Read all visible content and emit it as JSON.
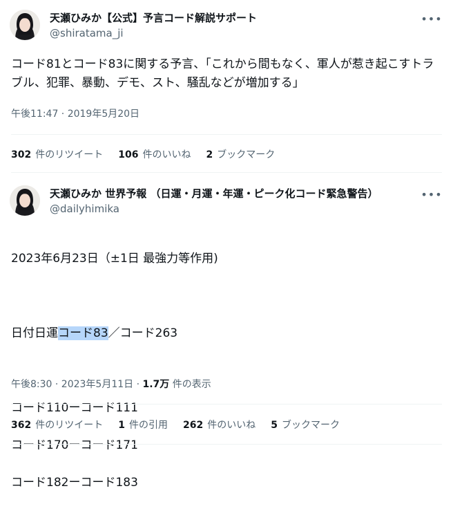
{
  "tweet1": {
    "display_name": "天瀬ひみか【公式】予言コード解説サポート",
    "handle": "@shiratama_ji",
    "text": "コード81とコード83に関する予言、「これから間もなく、軍人が惹き起こすトラブル、犯罪、暴動、デモ、スト、騒乱などが増加する」",
    "timestamp": "午後11:47 · 2019年5月20日",
    "stats": [
      {
        "count": "302",
        "label": "件のリツイート"
      },
      {
        "count": "106",
        "label": "件のいいね"
      },
      {
        "count": "2",
        "label": "ブックマーク"
      }
    ]
  },
  "tweet2": {
    "display_name": "天瀬ひみか 世界予報 （日運・月運・年運・ピーク化コード緊急警告）",
    "handle": "@dailyhimika",
    "line1": "2023年6月23日（±1日 最強力等作用)",
    "line2_prefix": "日付日運",
    "line2_highlight": "コード83",
    "line2_suffix": "／コード263",
    "line3": "コード110ーコード111",
    "line4": "コード170ーコード171",
    "line5": "コード182ーコード183",
    "timestamp": "午後8:30 · 2023年5月11日 · ",
    "views_count": "1.7万",
    "views_label": " 件の表示",
    "stats": [
      {
        "count": "362",
        "label": "件のリツイート"
      },
      {
        "count": "1",
        "label": "件の引用"
      },
      {
        "count": "262",
        "label": "件のいいね"
      },
      {
        "count": "5",
        "label": "ブックマーク"
      }
    ]
  },
  "icons": {
    "more": "more-horizontal-icon"
  }
}
